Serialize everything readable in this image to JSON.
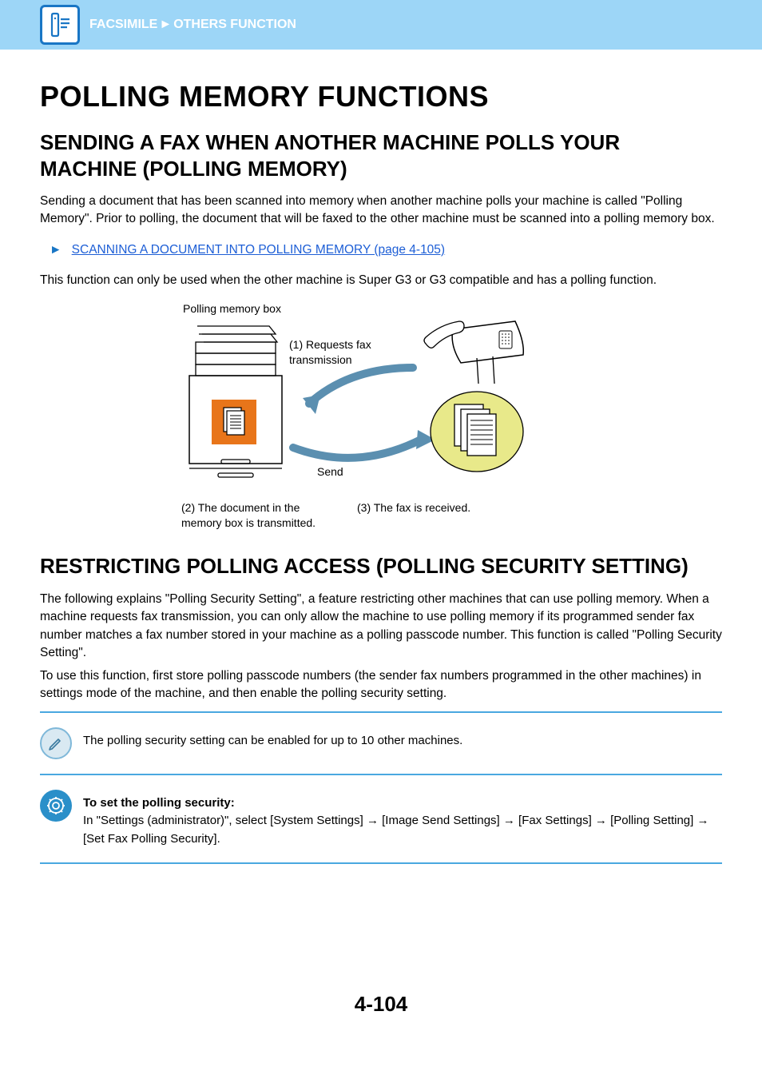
{
  "header": {
    "breadcrumb_section": "FACSIMILE",
    "breadcrumb_sep": "►",
    "breadcrumb_sub": "OTHERS FUNCTION"
  },
  "titles": {
    "h1": "POLLING MEMORY FUNCTIONS",
    "h2a": "SENDING A FAX WHEN ANOTHER MACHINE POLLS YOUR MACHINE (POLLING MEMORY)",
    "h2b": "RESTRICTING POLLING ACCESS (POLLING SECURITY SETTING)"
  },
  "body": {
    "intro": "Sending a document that has been scanned into memory when another machine polls your machine is called \"Polling Memory\". Prior to polling, the document that will be faxed to the other machine must be scanned into a polling memory box.",
    "link_arrow": "►",
    "link_text": "SCANNING A DOCUMENT INTO POLLING MEMORY (page 4-105)",
    "compat": "This function can only be used when the other machine is Super G3 or G3 compatible and has a polling function.",
    "restrict_p1": "The following explains \"Polling Security Setting\", a feature restricting other machines that can use polling memory. When a machine requests fax transmission, you can only allow the machine to use polling memory if its programmed sender fax number matches a fax number stored in your machine as a polling passcode number. This function is called \"Polling Security Setting\".",
    "restrict_p2": "To use this function, first store polling passcode numbers (the sender fax numbers programmed in the other machines) in settings mode of the machine, and then enable the polling security setting."
  },
  "diagram": {
    "top_label": "Polling memory box",
    "req_label": "(1) Requests fax transmission",
    "send_label": "Send",
    "cap2": "(2) The document in the memory box is transmitted.",
    "cap3": "(3) The fax is received."
  },
  "notes": {
    "pencil": "The polling security setting can be enabled for up to 10 other machines.",
    "gear_title": "To set the polling security:",
    "gear_body": "In \"Settings (administrator)\", select [System Settings] → [Image Send Settings] → [Fax Settings] → [Polling Setting] → [Set Fax Polling Security]."
  },
  "page_number": "4-104"
}
